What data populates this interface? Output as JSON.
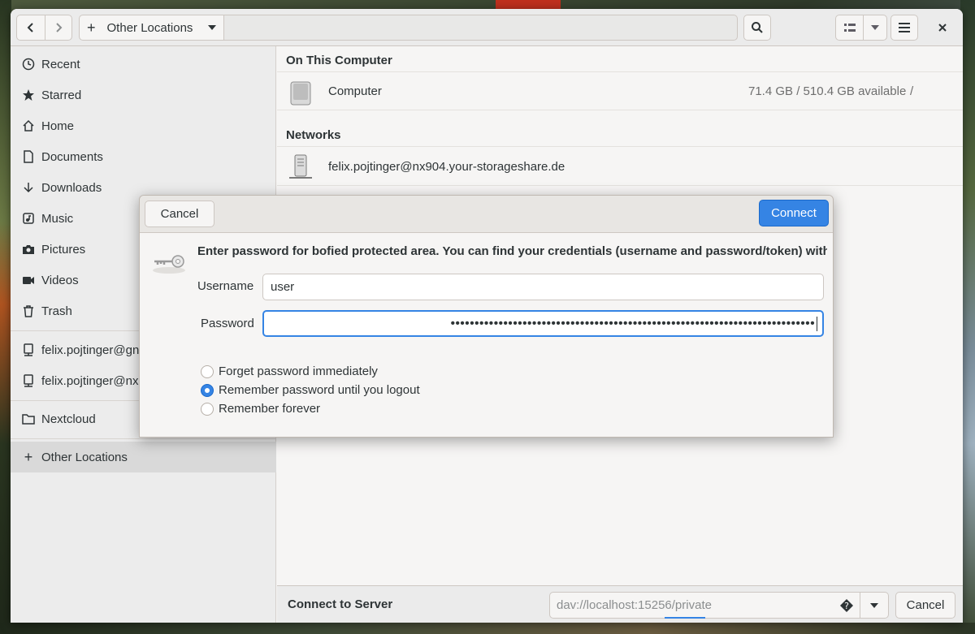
{
  "colors": {
    "accent": "#3584e4",
    "window_bg": "#f6f5f4",
    "sidebar_bg": "#ececec"
  },
  "header": {
    "back_icon": "chevron-left-icon",
    "forward_icon": "chevron-right-icon",
    "location_label": "Other Locations",
    "search_icon": "search-icon",
    "view_icon": "list-view-icon",
    "menu_icon": "hamburger-menu-icon",
    "close_icon": "close-icon"
  },
  "sidebar": {
    "items": [
      {
        "label": "Recent",
        "icon": "clock-icon"
      },
      {
        "label": "Starred",
        "icon": "star-icon"
      },
      {
        "label": "Home",
        "icon": "home-icon"
      },
      {
        "label": "Documents",
        "icon": "document-icon"
      },
      {
        "label": "Downloads",
        "icon": "download-icon"
      },
      {
        "label": "Music",
        "icon": "music-icon"
      },
      {
        "label": "Pictures",
        "icon": "camera-icon"
      },
      {
        "label": "Videos",
        "icon": "video-icon"
      },
      {
        "label": "Trash",
        "icon": "trash-icon"
      },
      {
        "label": "felix.pojtinger@gn",
        "icon": "network-server-icon"
      },
      {
        "label": "felix.pojtinger@nx",
        "icon": "network-server-icon"
      },
      {
        "label": "Nextcloud",
        "icon": "folder-icon"
      },
      {
        "label": "Other Locations",
        "icon": "plus-icon"
      }
    ]
  },
  "main": {
    "on_this_computer": "On This Computer",
    "computer": {
      "name": "Computer",
      "space": "71.4 GB / 510.4 GB available",
      "mount": "/"
    },
    "networks": "Networks",
    "network_entry": "felix.pojtinger@nx904.your-storageshare.de"
  },
  "bottom": {
    "label": "Connect to Server",
    "server_placeholder": "dav://localhost:15256/private",
    "cancel": "Cancel"
  },
  "dialog": {
    "cancel": "Cancel",
    "connect": "Connect",
    "message": "Enter password for bofied protected area. You can find your credentials (username and password/token) with the",
    "username_label": "Username",
    "username_value": "user",
    "password_label": "Password",
    "password_value": "••••••••••••••••••••••••••••••••••••••••••••••••••••••••••••••••••••••••••••",
    "options": [
      {
        "label": "Forget password immediately",
        "selected": false
      },
      {
        "label": "Remember password until you logout",
        "selected": true
      },
      {
        "label": "Remember forever",
        "selected": false
      }
    ]
  }
}
